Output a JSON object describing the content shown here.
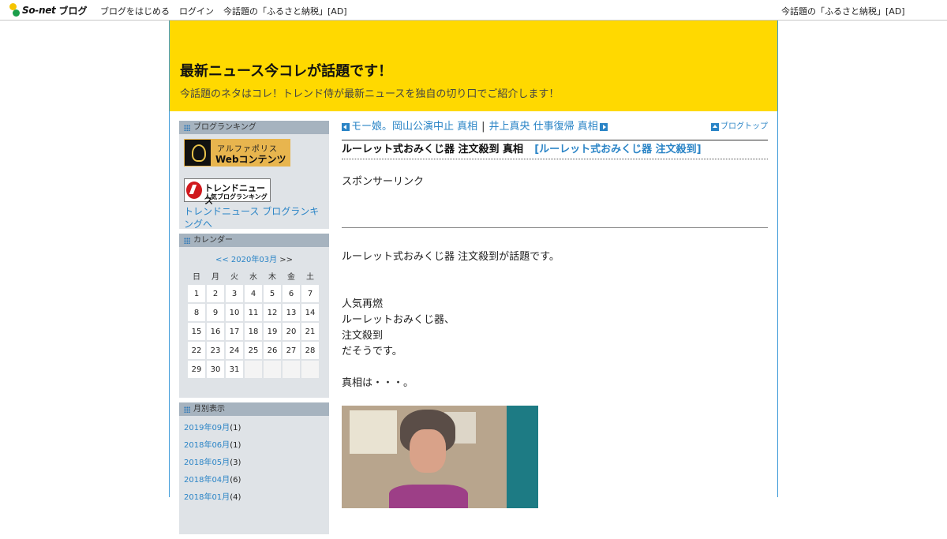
{
  "topbar": {
    "brand": "So-net",
    "brand_suffix": "ブログ",
    "nav": [
      "ブログをはじめる",
      "ログイン",
      "今話題の「ふるさと納税」[AD]"
    ],
    "right_ad": "今話題の「ふるさと納税」[AD]"
  },
  "header": {
    "title": "最新ニュース今コレが話題です！",
    "subtitle": "今話題のネタはコレ！トレンド侍が最新ニュースを独自の切り口でご紹介します！",
    "bg_color": "#ffd900"
  },
  "sidebar": {
    "ranking": {
      "heading": "ブログランキング",
      "alpha_line1": "アルファポリス",
      "alpha_line2": "Webコンテンツ",
      "trend_line1": "トレンドニュース",
      "trend_line2": "人気ブログランキング",
      "trend_link": "トレンドニュース ブログランキングへ"
    },
    "calendar": {
      "heading": "カレンダー",
      "prev": "<<",
      "month": "2020年03月",
      "next": ">>",
      "weekdays": [
        "日",
        "月",
        "火",
        "水",
        "木",
        "金",
        "土"
      ],
      "weeks": [
        [
          "1",
          "2",
          "3",
          "4",
          "5",
          "6",
          "7"
        ],
        [
          "8",
          "9",
          "10",
          "11",
          "12",
          "13",
          "14"
        ],
        [
          "15",
          "16",
          "17",
          "18",
          "19",
          "20",
          "21"
        ],
        [
          "22",
          "23",
          "24",
          "25",
          "26",
          "27",
          "28"
        ],
        [
          "29",
          "30",
          "31",
          "",
          "",
          "",
          ""
        ]
      ]
    },
    "monthly": {
      "heading": "月別表示",
      "items": [
        {
          "label": "2019年09月",
          "count": "(1)"
        },
        {
          "label": "2018年06月",
          "count": "(1)"
        },
        {
          "label": "2018年05月",
          "count": "(3)"
        },
        {
          "label": "2018年04月",
          "count": "(6)"
        },
        {
          "label": "2018年01月",
          "count": "(4)"
        }
      ]
    }
  },
  "main": {
    "prev_post": "モー娘。岡山公演中止 真相",
    "separator": "|",
    "next_post": "井上真央 仕事復帰 真相",
    "blog_top": "ブログトップ",
    "post_title": "ルーレット式おみくじ器 注文殺到 真相",
    "post_tag": "[ルーレット式おみくじ器 注文殺到]",
    "sponsor": "スポンサーリンク",
    "paragraph1": "ルーレット式おみくじ器 注文殺到が話題です。",
    "lines": [
      "人気再燃",
      "ルーレットおみくじ器、",
      "注文殺到",
      "だそうです。"
    ],
    "paragraph_last": "真相は・・・。",
    "link_color": "#2a84c6"
  }
}
